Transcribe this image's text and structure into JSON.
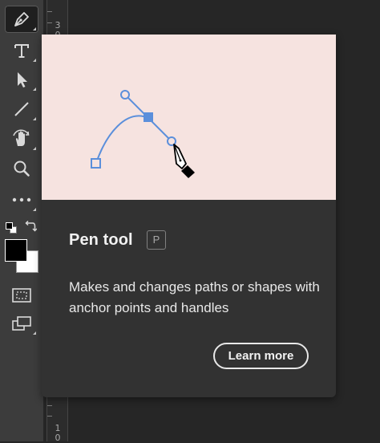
{
  "toolbar": {
    "tools": [
      {
        "name": "pen-tool",
        "icon": "pen-nib-icon",
        "active": true
      },
      {
        "name": "type-tool",
        "icon": "type-T-icon"
      },
      {
        "name": "path-selection-tool",
        "icon": "arrow-cursor-icon"
      },
      {
        "name": "line-tool",
        "icon": "line-icon"
      },
      {
        "name": "hand-tool",
        "icon": "rotate-hand-icon"
      },
      {
        "name": "zoom-tool",
        "icon": "magnifier-icon"
      },
      {
        "name": "more-tools",
        "icon": "ellipsis-icon"
      }
    ],
    "foreground_color": "#000000",
    "background_color": "#ffffff"
  },
  "ruler": {
    "top_labels": [
      "3",
      "0"
    ],
    "bottom_labels": [
      "1",
      "0"
    ]
  },
  "tooltip": {
    "title": "Pen tool",
    "shortcut": "P",
    "description": "Makes and changes paths or shapes with anchor points and handles",
    "button_label": "Learn more",
    "preview_background": "#f6e3e0",
    "accent_color": "#5b8fdb"
  }
}
